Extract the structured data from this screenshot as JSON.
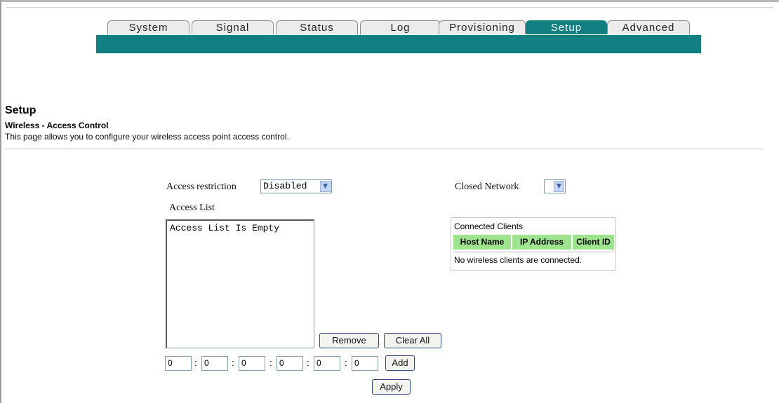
{
  "tabs": [
    {
      "label": "System",
      "active": false
    },
    {
      "label": "Signal",
      "active": false
    },
    {
      "label": "Status",
      "active": false
    },
    {
      "label": "Log",
      "active": false
    },
    {
      "label": "Provisioning",
      "active": false
    },
    {
      "label": "Setup",
      "active": true
    },
    {
      "label": "Advanced",
      "active": false
    }
  ],
  "colors": {
    "accent": "#0f7f82",
    "client_header": "#9ee48f"
  },
  "page": {
    "title": "Setup",
    "subtitle": "Wireless - Access Control",
    "description": "This page allows you to configure your wireless access point access control."
  },
  "access_restriction": {
    "label": "Access restriction",
    "value": "Disabled"
  },
  "closed_network": {
    "label": "Closed Network",
    "value": ""
  },
  "access_list": {
    "label": "Access List",
    "content": "Access List Is Empty"
  },
  "buttons": {
    "remove": "Remove",
    "clear_all": "Clear All",
    "add": "Add",
    "apply": "Apply"
  },
  "mac_fields": [
    "0",
    "0",
    "0",
    "0",
    "0",
    "0"
  ],
  "mac_separator": ":",
  "connected_clients": {
    "caption": "Connected Clients",
    "columns": [
      "Host Name",
      "IP Address",
      "Client ID"
    ],
    "empty_message": "No wireless clients are connected."
  }
}
